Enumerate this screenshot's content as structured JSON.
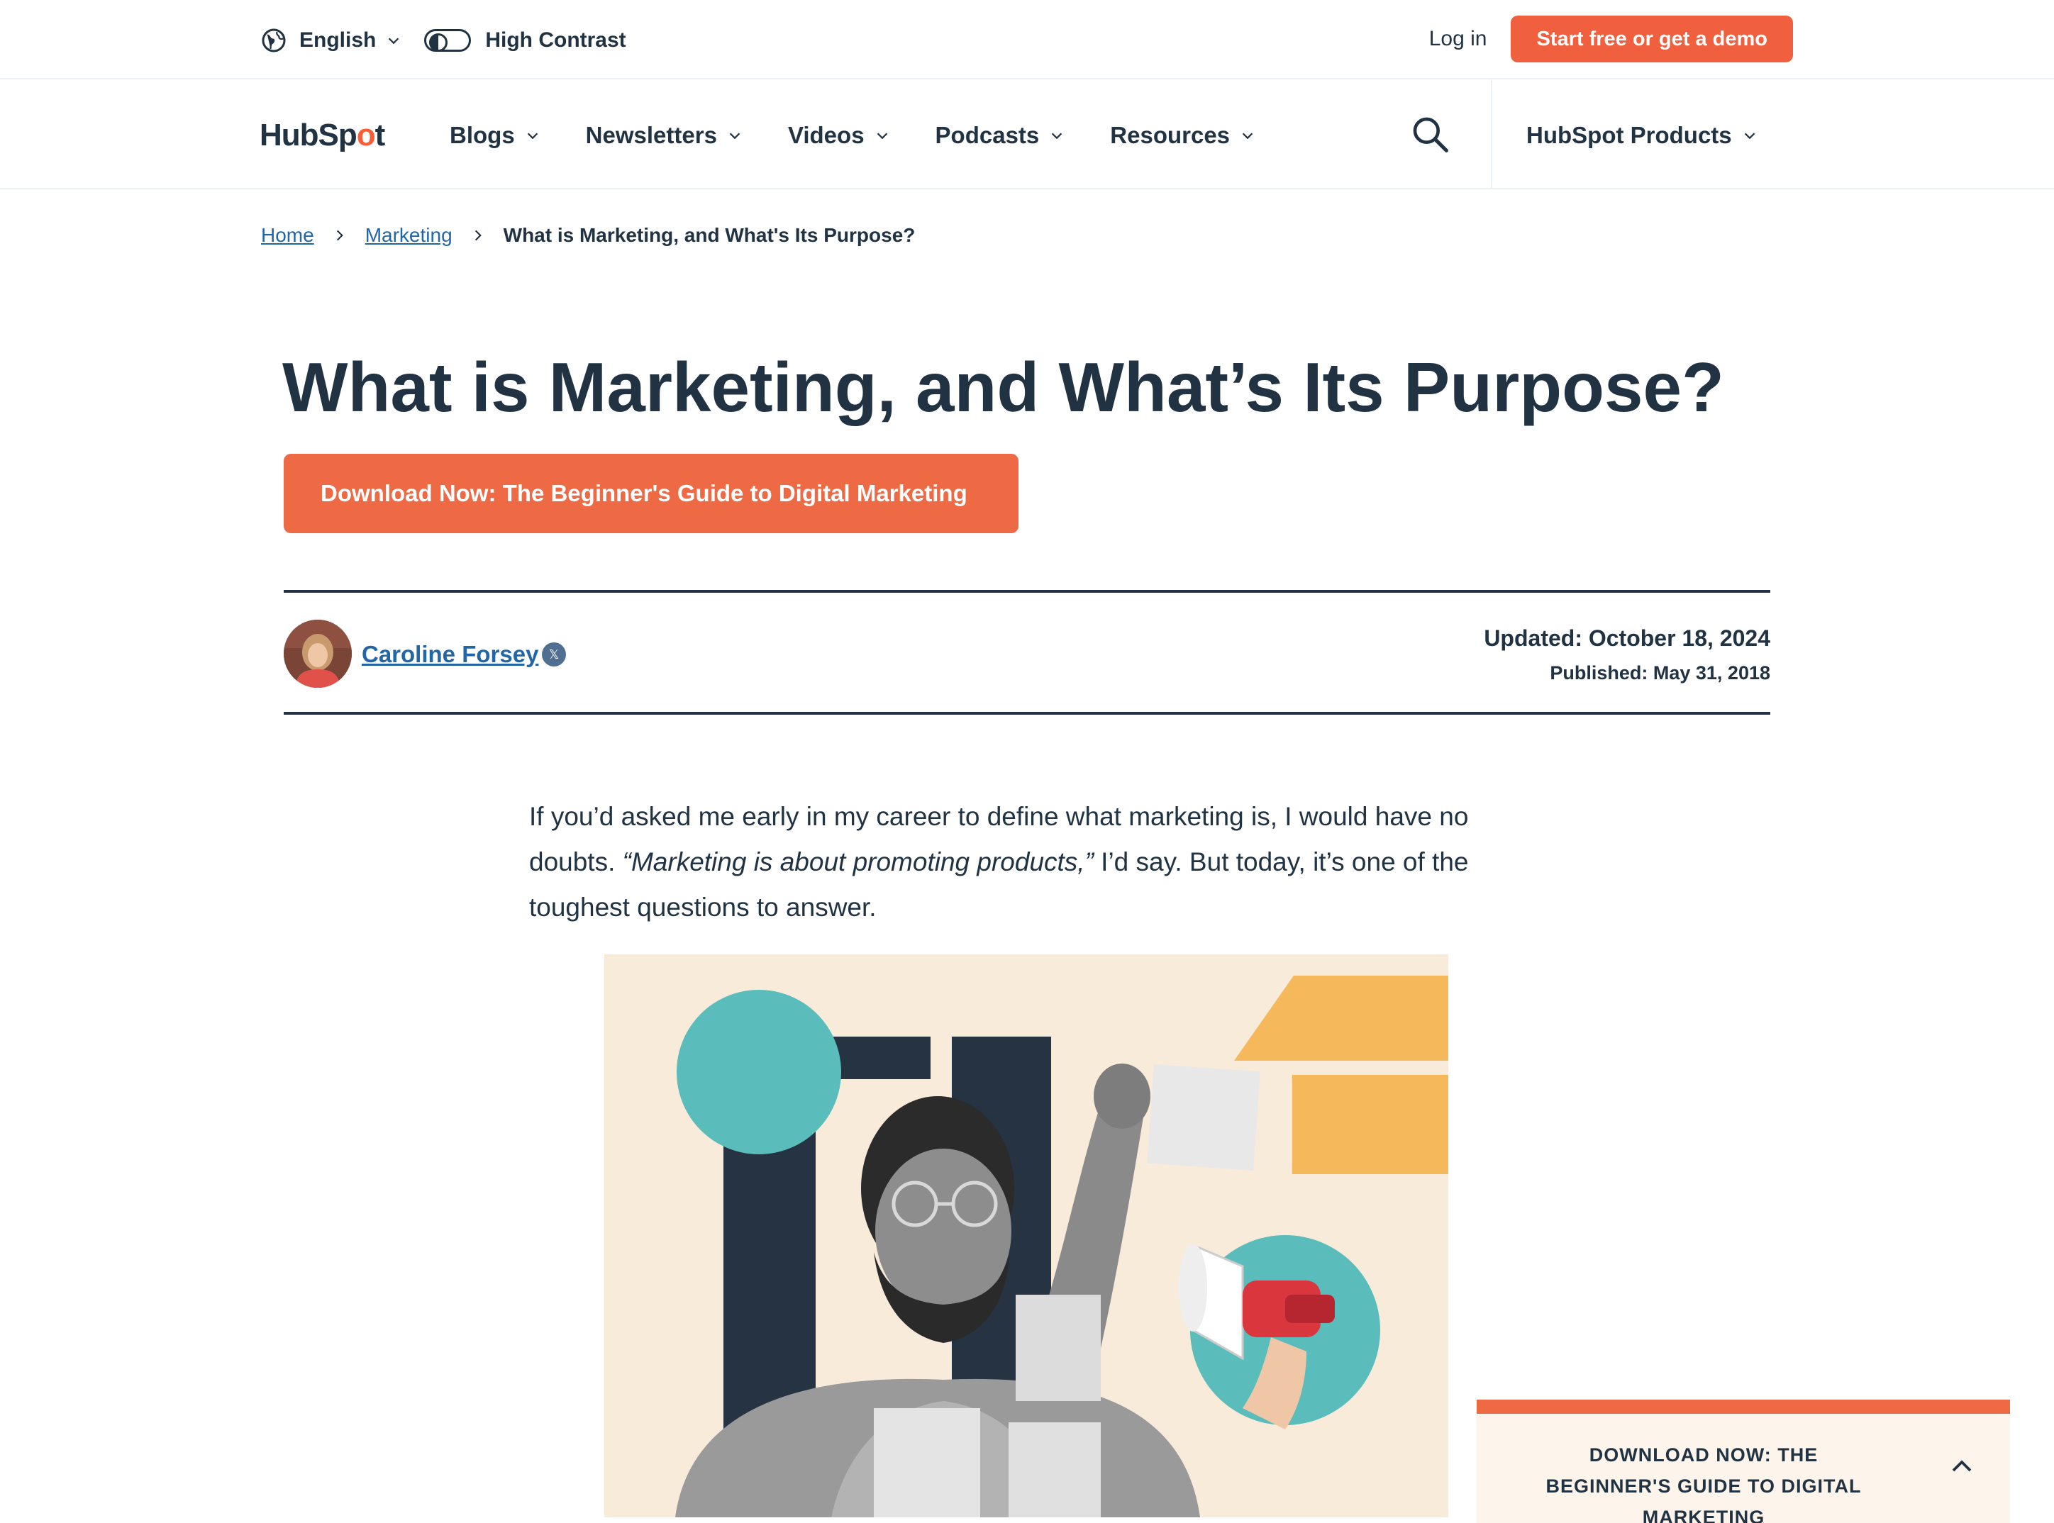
{
  "utility": {
    "language": "English",
    "contrast_label": "High Contrast",
    "login": "Log in",
    "cta": "Start free or get a demo"
  },
  "nav": {
    "logo_prefix": "HubSp",
    "logo_o": "o",
    "logo_suffix": "t",
    "items": [
      "Blogs",
      "Newsletters",
      "Videos",
      "Podcasts",
      "Resources"
    ],
    "products": "HubSpot Products"
  },
  "breadcrumb": {
    "home": "Home",
    "section": "Marketing",
    "current": "What is Marketing, and What's Its Purpose?"
  },
  "article": {
    "title": "What is Marketing, and What’s Its Purpose?",
    "download_cta": "Download Now: The Beginner's Guide to Digital Marketing",
    "author": "Caroline Forsey",
    "updated": "Updated: October 18, 2024",
    "published": "Published: May 31, 2018",
    "intro_1": "If you’d asked me early in my career to define what marketing is, I would have no doubts. ",
    "intro_quote": "“Marketing is about promoting products,”",
    "intro_2": " I’d say. But today, it’s one of the toughest questions to answer."
  },
  "sticky": {
    "text": "DOWNLOAD NOW: THE BEGINNER'S GUIDE TO DIGITAL MARKETING"
  },
  "icons": {
    "language": "globe-icon",
    "search": "search-icon",
    "expand": "chevron-down-icon",
    "collapse": "chevron-up-icon",
    "separator": "chevron-right-icon",
    "social": "x-icon"
  },
  "colors": {
    "brand_orange": "#ee6a45",
    "text_dark": "#213343",
    "link_blue": "#2167a8",
    "teal": "#5bbcbc",
    "navy": "#253342",
    "yellow": "#f5b85b"
  }
}
